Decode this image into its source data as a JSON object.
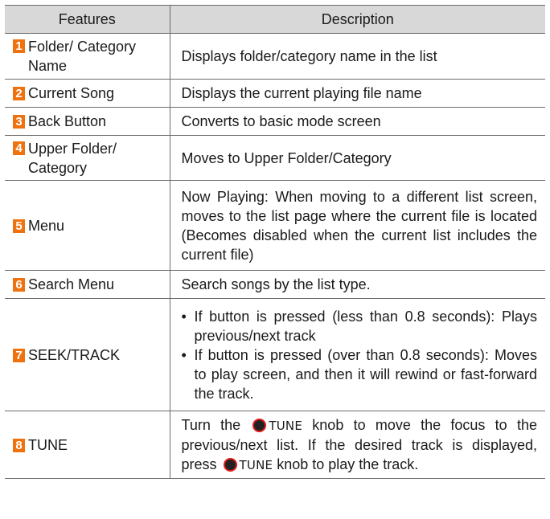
{
  "table": {
    "headers": [
      "Features",
      "Description"
    ],
    "rows": [
      {
        "num": "1",
        "feature": "Folder/ Category Name",
        "description": "Displays folder/category name in the list"
      },
      {
        "num": "2",
        "feature": "Current Song",
        "description": "Displays the current playing file name"
      },
      {
        "num": "3",
        "feature": "Back Button",
        "description": "Converts to basic mode screen"
      },
      {
        "num": "4",
        "feature": "Upper Folder/ Category",
        "description": "Moves to Upper Folder/Category"
      },
      {
        "num": "5",
        "feature": "Menu",
        "description": "Now Playing: When moving to a different list screen, moves to the list page where the current file is located (Becomes disabled when the current list includes the current file)"
      },
      {
        "num": "6",
        "feature": "Search Menu",
        "description": "Search songs by the list type."
      },
      {
        "num": "7",
        "feature": "SEEK/TRACK",
        "bullets": [
          "If button is pressed (less than 0.8 seconds): Plays previous/next track",
          "If button is pressed (over than 0.8 seconds): Moves to play screen, and then it will rewind or fast-forward the track."
        ]
      },
      {
        "num": "8",
        "feature": "TUNE",
        "description_parts": [
          "Turn the",
          "TUNE",
          "knob to move the focus to the previous/next list. If the desired track is displayed, press",
          "TUNE",
          "knob to play the track."
        ]
      }
    ]
  },
  "colors": {
    "number_badge": "#f0720f",
    "header_bg": "#d8d8d8",
    "knob_ring": "#e01818"
  },
  "icons": {
    "knob": "tune-knob-icon"
  }
}
